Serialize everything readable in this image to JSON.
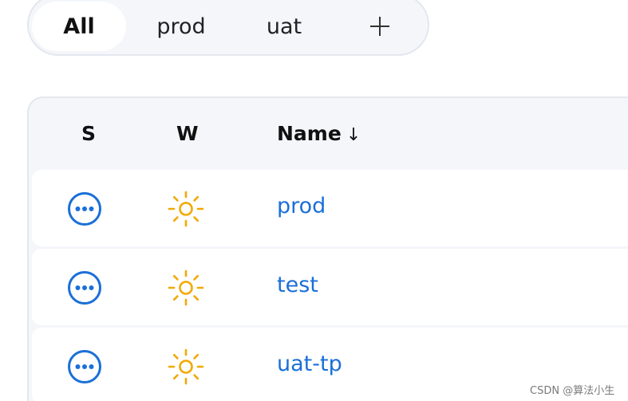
{
  "tabs": [
    {
      "label": "All",
      "active": true
    },
    {
      "label": "prod",
      "active": false
    },
    {
      "label": "uat",
      "active": false
    }
  ],
  "add_tab_icon": "plus-icon",
  "table": {
    "columns": {
      "status": "S",
      "weather": "W",
      "name": "Name",
      "name_sort": "↓"
    },
    "rows": [
      {
        "status_icon": "more-circle-icon",
        "weather_icon": "sun-icon",
        "name": "prod"
      },
      {
        "status_icon": "more-circle-icon",
        "weather_icon": "sun-icon",
        "name": "test"
      },
      {
        "status_icon": "more-circle-icon",
        "weather_icon": "sun-icon",
        "name": "uat-tp"
      }
    ]
  },
  "colors": {
    "accent": "#1a6fd8",
    "sun": "#f2a900",
    "surface": "#f4f6fa"
  },
  "watermark": "CSDN @算法小生"
}
